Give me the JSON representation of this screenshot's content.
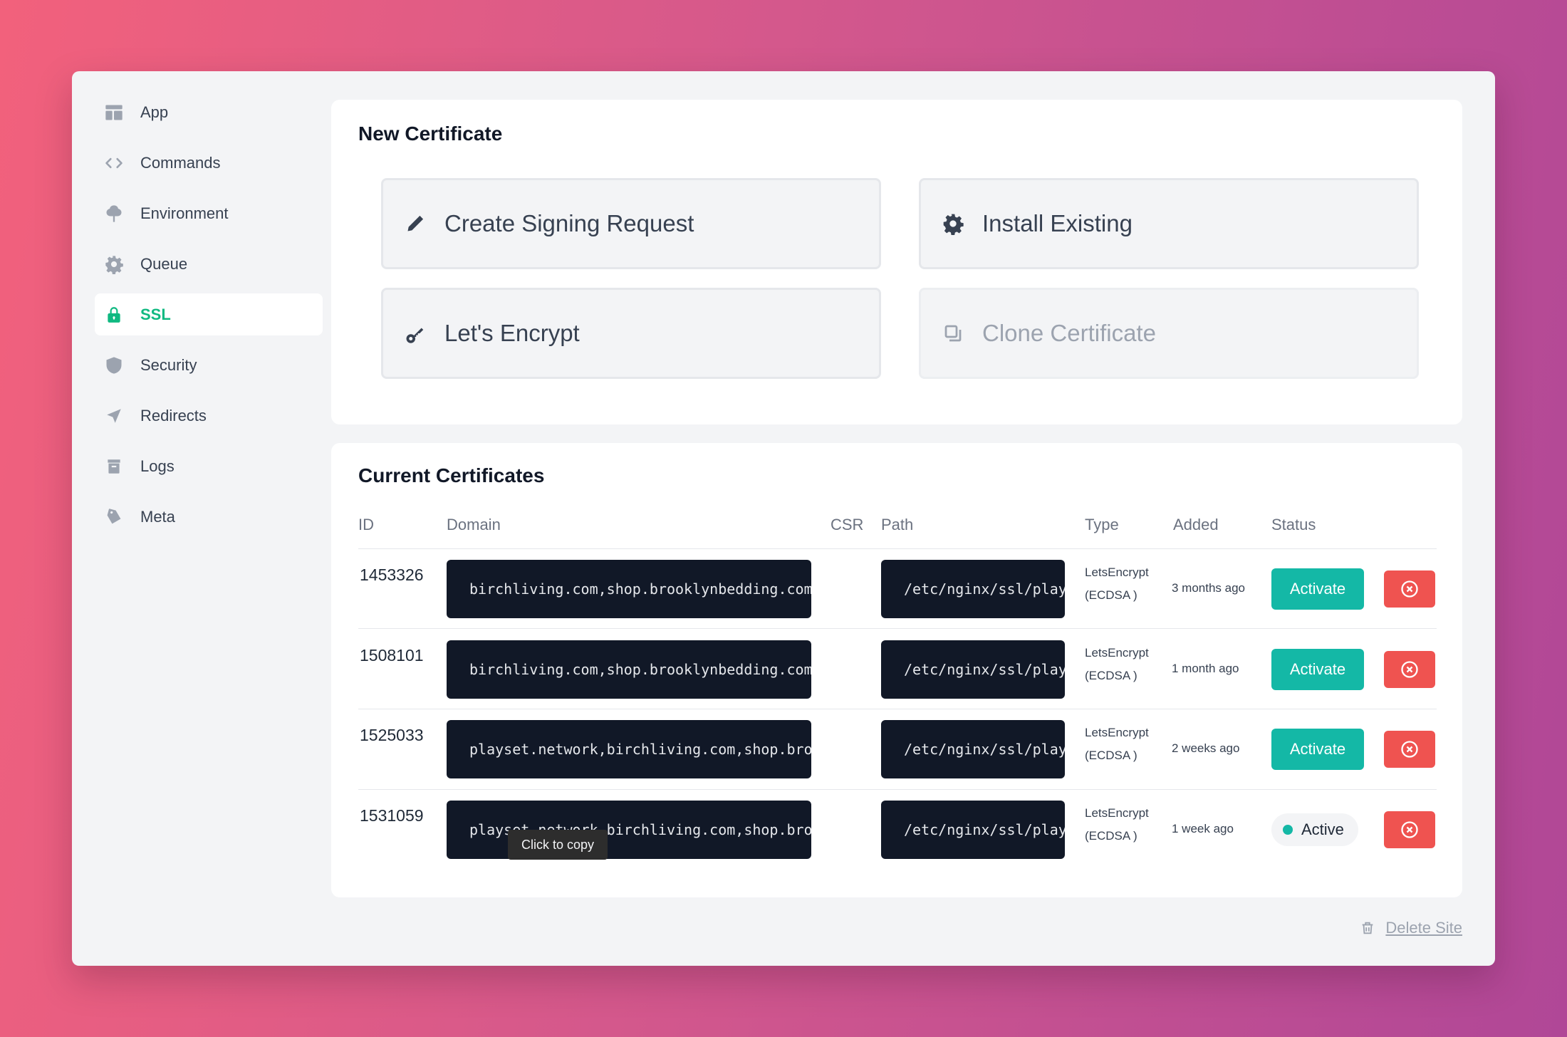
{
  "sidebar": {
    "items": [
      {
        "label": "App",
        "icon": "layout-icon"
      },
      {
        "label": "Commands",
        "icon": "code-icon"
      },
      {
        "label": "Environment",
        "icon": "tree-icon"
      },
      {
        "label": "Queue",
        "icon": "gear-icon"
      },
      {
        "label": "SSL",
        "icon": "lock-icon",
        "active": true
      },
      {
        "label": "Security",
        "icon": "shield-icon"
      },
      {
        "label": "Redirects",
        "icon": "send-icon"
      },
      {
        "label": "Logs",
        "icon": "archive-icon"
      },
      {
        "label": "Meta",
        "icon": "tag-icon"
      }
    ]
  },
  "new_certificate": {
    "title": "New Certificate",
    "options": [
      {
        "label": "Create Signing Request",
        "icon": "pencil-icon"
      },
      {
        "label": "Install Existing",
        "icon": "gear-icon"
      },
      {
        "label": "Let's Encrypt",
        "icon": "key-icon"
      },
      {
        "label": "Clone Certificate",
        "icon": "copy-icon",
        "disabled": true
      }
    ]
  },
  "current_certificates": {
    "title": "Current Certificates",
    "columns": [
      "ID",
      "Domain",
      "CSR",
      "Path",
      "Type",
      "Added",
      "Status"
    ],
    "rows": [
      {
        "id": "1453326",
        "domain": "birchliving.com,shop.brooklynbedding.com",
        "path": "/etc/nginx/ssl/playset.network",
        "type_line1": "LetsEncrypt",
        "type_line2": "(ECDSA )",
        "added": "3 months ago",
        "status": "Activate"
      },
      {
        "id": "1508101",
        "domain": "birchliving.com,shop.brooklynbedding.com,playset.network",
        "path": "/etc/nginx/ssl/playset.network",
        "type_line1": "LetsEncrypt",
        "type_line2": "(ECDSA )",
        "added": "1 month ago",
        "status": "Activate"
      },
      {
        "id": "1525033",
        "domain": "playset.network,birchliving.com,shop.brooklynbedding.com",
        "path": "/etc/nginx/ssl/playset.network",
        "type_line1": "LetsEncrypt",
        "type_line2": "(ECDSA )",
        "added": "2 weeks ago",
        "status": "Activate"
      },
      {
        "id": "1531059",
        "domain": "playset.network,birchliving.com,shop.brooklynbedding.com",
        "path": "/etc/nginx/ssl/playset.network",
        "type_line1": "LetsEncrypt",
        "type_line2": "(ECDSA )",
        "added": "1 week ago",
        "status": "Active"
      }
    ],
    "tooltip": "Click to copy"
  },
  "footer": {
    "delete_site_label": "Delete Site"
  },
  "colors": {
    "accent": "#14b8a6",
    "danger": "#ef5350",
    "code_bg": "#111827"
  }
}
